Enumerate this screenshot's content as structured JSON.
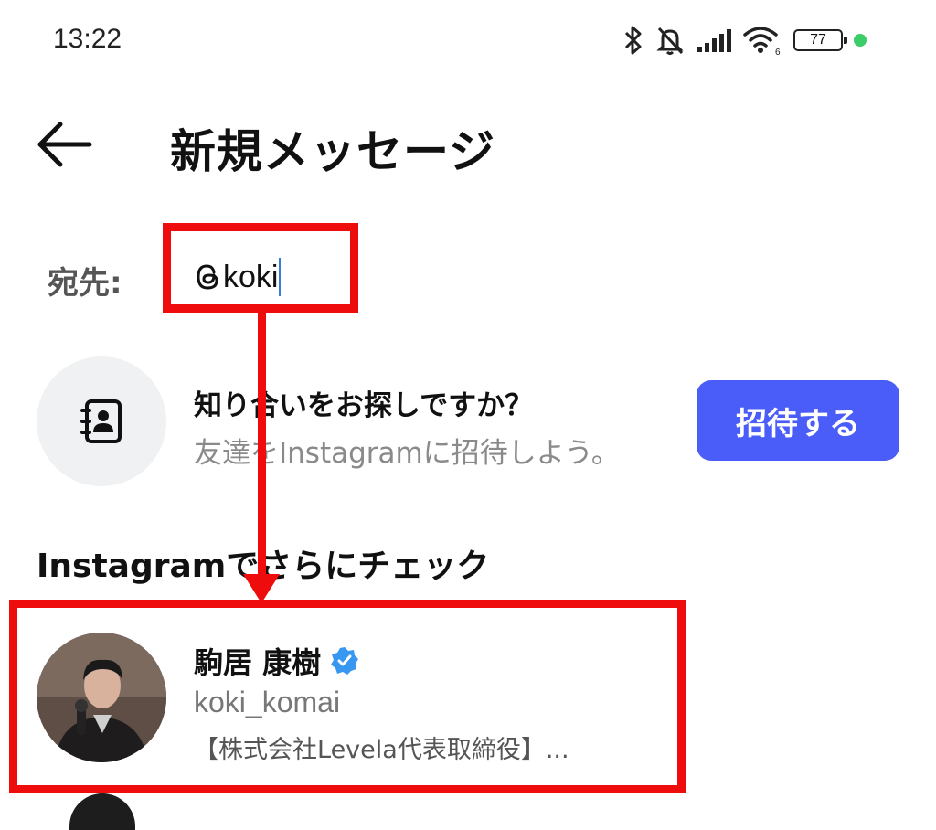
{
  "status_bar": {
    "time": "13:22",
    "battery": "77",
    "icons": [
      "bluetooth-icon",
      "bell-muted-icon",
      "signal-icon",
      "wifi-icon",
      "battery-icon",
      "dot-indicator-icon"
    ]
  },
  "header": {
    "title": "新規メッセージ",
    "back_icon": "arrow-left-icon"
  },
  "recipient": {
    "label": "宛先:",
    "value": "koki",
    "prefix_icon": "threads-logo-icon"
  },
  "suggestion": {
    "title": "知り合いをお探しですか？",
    "subtitle": "友達をInstagramに招待しよう。",
    "button": "招待する",
    "icon": "contacts-book-icon"
  },
  "section": {
    "heading": "Instagramでさらにチェック"
  },
  "results": [
    {
      "name": "駒居 康樹",
      "verified": true,
      "username": "koki_komai",
      "bio": "【株式会社Levela代表取締役】..."
    }
  ],
  "colors": {
    "accent": "#4a5df9",
    "annotation_red": "#ee0c0c",
    "verified_blue": "#3897f0",
    "muted_text": "#8a8a8a"
  }
}
